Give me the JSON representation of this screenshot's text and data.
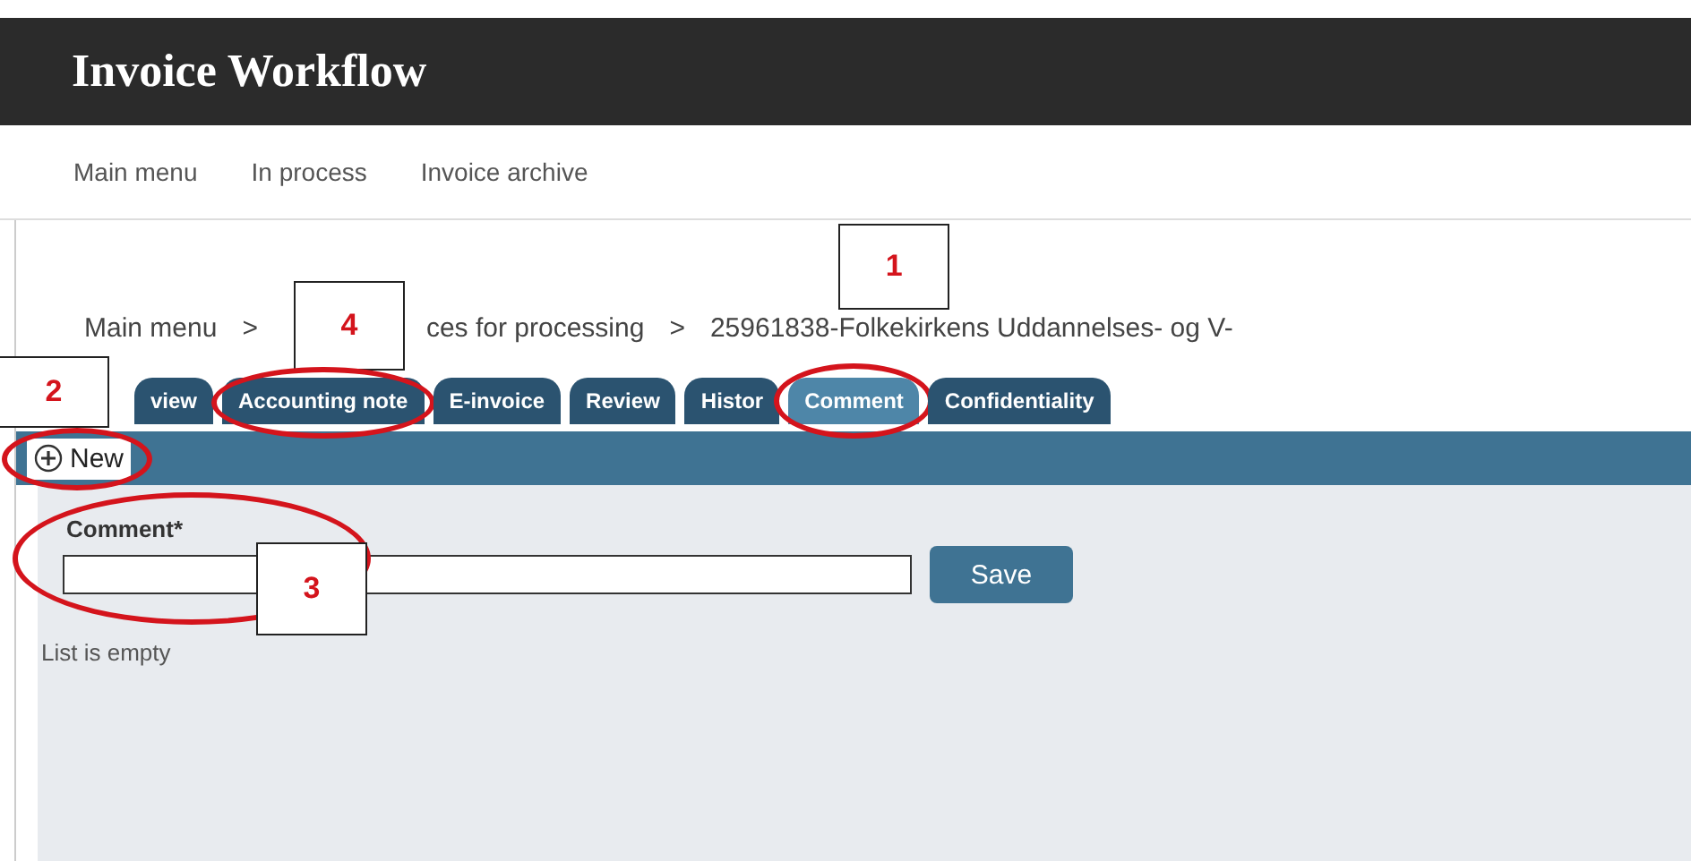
{
  "header": {
    "title": "Invoice Workflow"
  },
  "nav": [
    "Main menu",
    "In process",
    "Invoice archive"
  ],
  "breadcrumb": [
    "Main menu",
    ">",
    "ces for processing",
    ">",
    "25961838-Folkekirkens Uddannelses- og V-"
  ],
  "tabs": [
    {
      "label": "view",
      "selected": false
    },
    {
      "label": "Accounting note",
      "selected": false
    },
    {
      "label": "E-invoice",
      "selected": false
    },
    {
      "label": "Review",
      "selected": false
    },
    {
      "label": "Histor",
      "selected": false
    },
    {
      "label": "Comment",
      "selected": true
    },
    {
      "label": "Confidentiality",
      "selected": false
    }
  ],
  "toolbar": {
    "new_button": "New"
  },
  "form": {
    "label": "Comment*",
    "save_button": "Save"
  },
  "list": {
    "empty_text": "List is empty"
  },
  "annotations": [
    {
      "label": "1"
    },
    {
      "label": "2"
    },
    {
      "label": "3"
    },
    {
      "label": "4"
    }
  ]
}
